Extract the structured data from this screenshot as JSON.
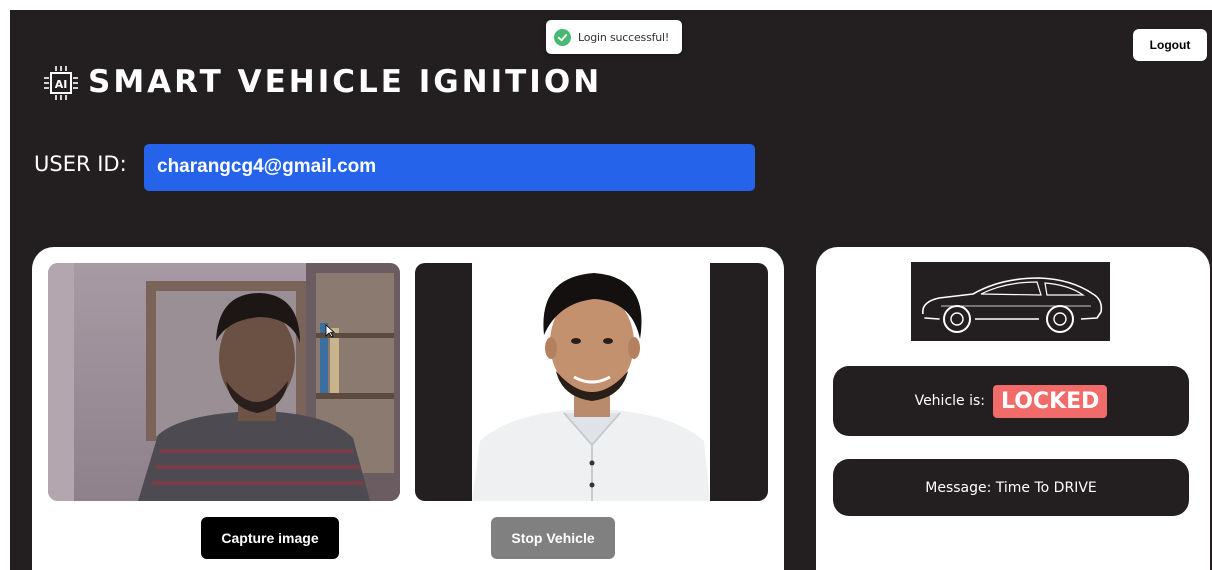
{
  "toast": {
    "text": "Login successful!",
    "icon": "check-circle-icon",
    "icon_color": "#47b972"
  },
  "header": {
    "title": "SMART VEHICLE IGNITION",
    "logo_text": "AI",
    "logout_label": "Logout"
  },
  "user": {
    "label": "USER ID:",
    "value": "charangcg4@gmail.com"
  },
  "camera": {
    "capture_label": "Capture image",
    "stop_label": "Stop Vehicle"
  },
  "vehicle": {
    "status_label": "Vehicle is:",
    "status_value": "LOCKED",
    "status_color": "#f16b6b",
    "message_label": "Message:",
    "message_value": "Time To DRIVE"
  },
  "colors": {
    "background": "#231f20",
    "accent": "#2563eb",
    "panel": "#ffffff"
  }
}
